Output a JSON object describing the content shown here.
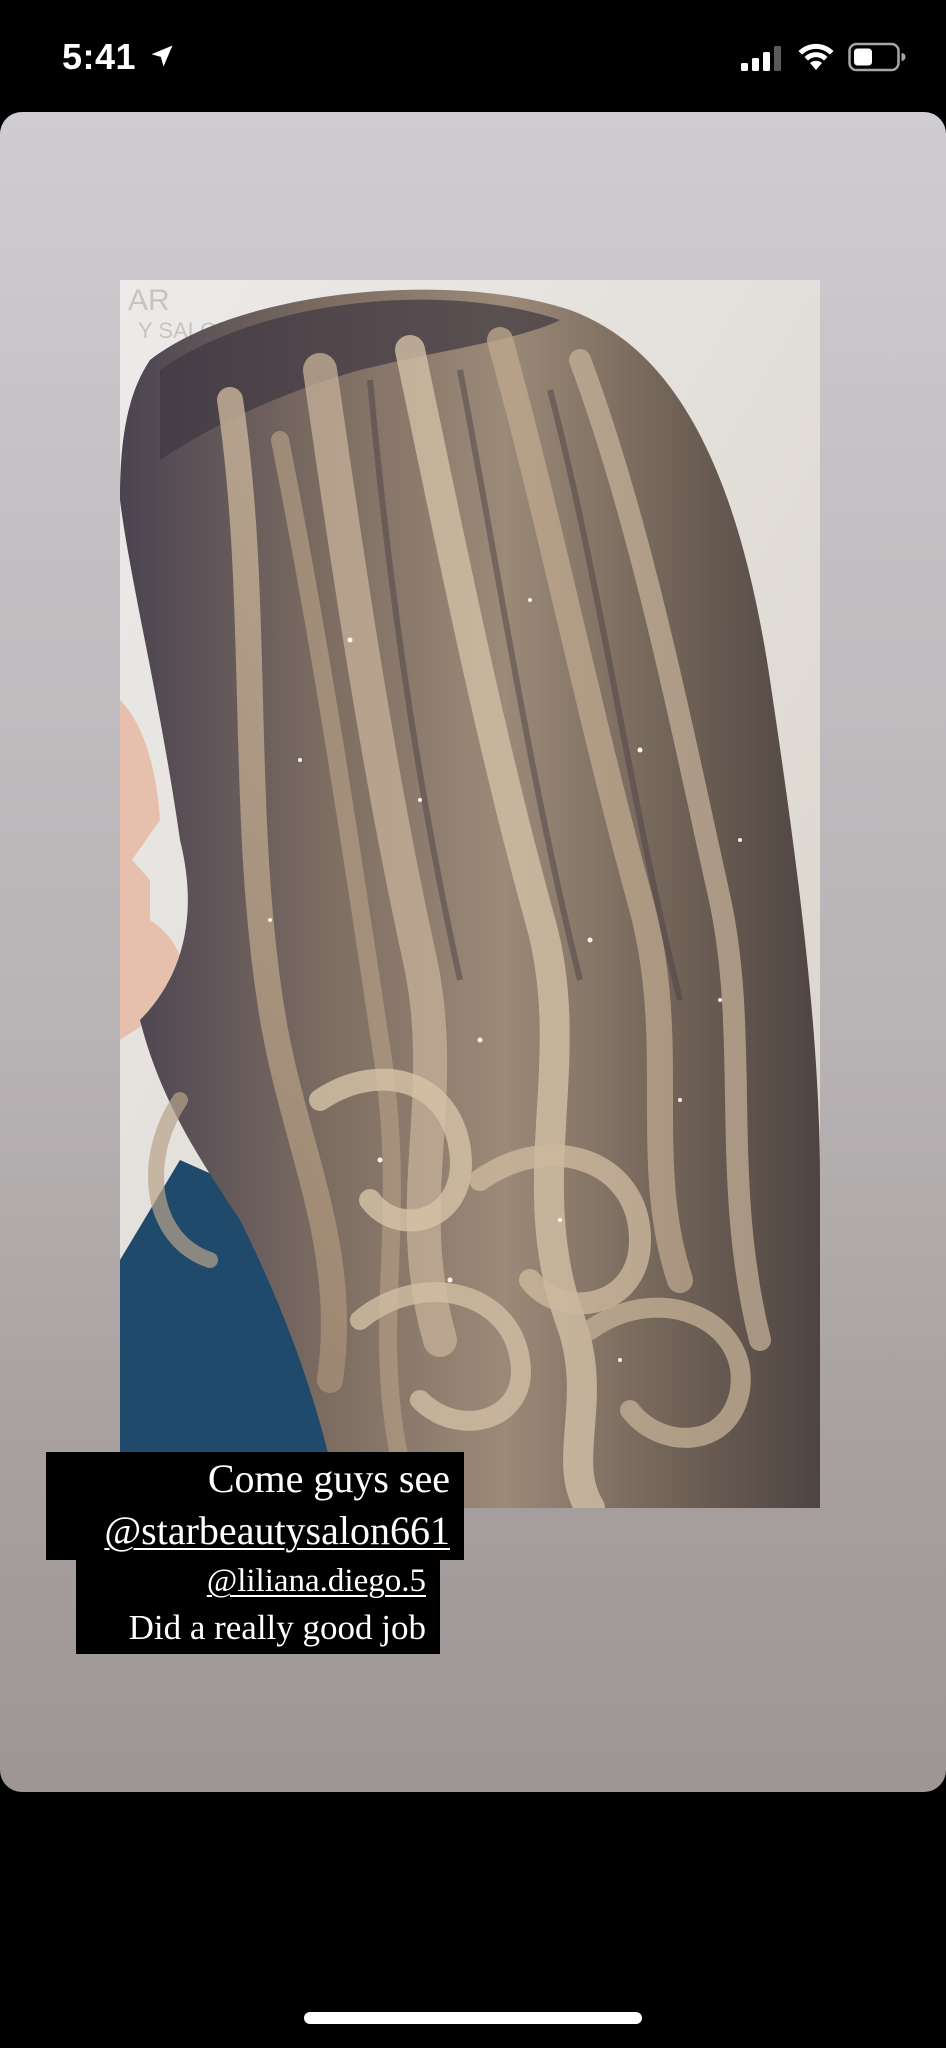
{
  "status_bar": {
    "time": "5:41",
    "icons": [
      "location-arrow-icon",
      "cellular-signal-icon",
      "wifi-icon",
      "battery-icon"
    ]
  },
  "story": {
    "image": "hair-highlights-photo",
    "caption": {
      "line1": "Come guys see",
      "mention1": "@starbeautysalon661",
      "mention2": "@liliana.diego.5",
      "line4": "Did a  really good job"
    }
  },
  "colors": {
    "background": "#000000",
    "card_top": "#cfcdd1",
    "card_bottom": "#9e9695",
    "caption_bg": "#000000",
    "caption_text": "#ffffff"
  }
}
